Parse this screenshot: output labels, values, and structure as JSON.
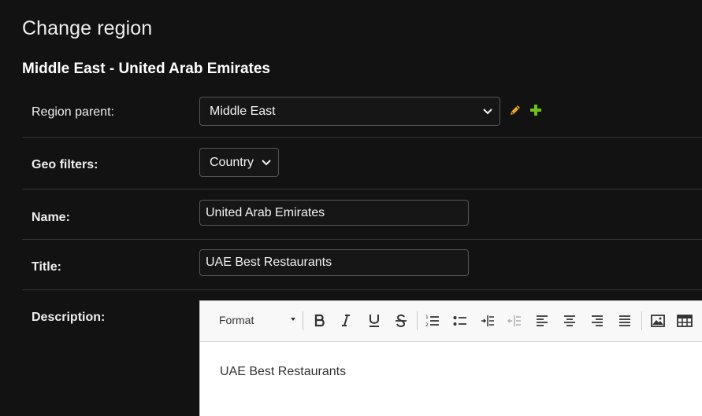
{
  "page": {
    "title": "Change region",
    "fieldset_title": "Middle East - United Arab Emirates"
  },
  "form": {
    "region_parent": {
      "label": "Region parent:",
      "value": "Middle East"
    },
    "geo_filters": {
      "label": "Geo filters:",
      "value": "Country"
    },
    "name": {
      "label": "Name:",
      "value": "United Arab Emirates"
    },
    "title": {
      "label": "Title:",
      "value": "UAE Best Restaurants"
    },
    "description": {
      "label": "Description:",
      "toolbar": {
        "format_label": "Format"
      },
      "content": "UAE Best Restaurants"
    }
  },
  "colors": {
    "background": "#121212",
    "edit_icon": "#e5a82a",
    "add_icon": "#6ec11d"
  },
  "icons": [
    "pencil-icon",
    "plus-icon",
    "chevron-down-icon"
  ]
}
